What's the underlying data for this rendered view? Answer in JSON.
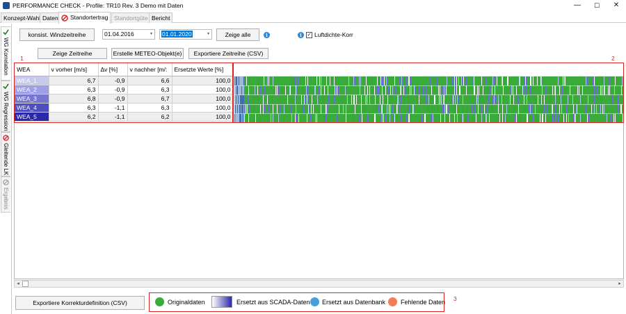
{
  "window": {
    "title": "PERFORMANCE CHECK - Profile: TR10 Rev. 3 Demo mit Daten",
    "controls": [
      "—",
      "☐",
      "✕"
    ]
  },
  "tabs": [
    {
      "label": "Konzept-Wahl",
      "state": "normal"
    },
    {
      "label": "Daten",
      "state": "normal"
    },
    {
      "label": "Standortertrag",
      "state": "active"
    },
    {
      "label": "Standortgüte",
      "state": "disabled"
    },
    {
      "label": "Bericht",
      "state": "normal"
    }
  ],
  "side_tabs": [
    {
      "label": "WG Korrelation",
      "icon": "check-icon"
    },
    {
      "label": "WG Regression",
      "icon": "check-icon"
    },
    {
      "label": "Gleitende LK",
      "icon": "blocked-icon"
    },
    {
      "label": "Ergebnis",
      "icon": "disabled-icon"
    }
  ],
  "toolbar": {
    "konsist_button": "konsist. Windzeitreihe",
    "start_date": "01.04.2016",
    "end_date": "01.01.2020",
    "show_all_button": "Zeige alle",
    "air_density_label": "Luftdichte-Korr",
    "air_density_checked": true,
    "show_series_button": "Zeige Zeitreihe",
    "create_meteo_button": "Erstelle METEO-Objekt(e)",
    "export_series_button": "Exportiere Zeitreihe (CSV)",
    "info_glyph": "i",
    "check_glyph": "✓",
    "dropdown_glyph": "▾"
  },
  "annotations": [
    "1",
    "2",
    "3"
  ],
  "table": {
    "columns": [
      "WEA",
      "v vorher [m/s]",
      "Δv [%]",
      "v nachher [m/:",
      "Ersetzte Werte [%]"
    ],
    "rows": [
      {
        "wea": "WEA_1",
        "v_before": "6,7",
        "delta": "-0,9",
        "v_after": "6,6",
        "replaced": "100,0",
        "color": "#c9c9f0"
      },
      {
        "wea": "WEA_2",
        "v_before": "6,3",
        "delta": "-0,9",
        "v_after": "6,3",
        "replaced": "100,0",
        "color": "#9f9fe6"
      },
      {
        "wea": "WEA_3",
        "v_before": "6,8",
        "delta": "-0,9",
        "v_after": "6,7",
        "replaced": "100,0",
        "color": "#7575d2"
      },
      {
        "wea": "WEA_4",
        "v_before": "6,3",
        "delta": "-1,1",
        "v_after": "6,3",
        "replaced": "100,0",
        "color": "#4f4fc0"
      },
      {
        "wea": "WEA_5",
        "v_before": "6,2",
        "delta": "-1,1",
        "v_after": "6,2",
        "replaced": "100,0",
        "color": "#2a2aa8"
      }
    ]
  },
  "scrollbar": {
    "left_arrow": "◂",
    "right_arrow": "▸"
  },
  "footer": {
    "export_button": "Exportiere Korrekturdefinition (CSV)"
  },
  "legend": [
    {
      "label": "Originaldaten",
      "color": "#3aaa3a",
      "kind": "dot"
    },
    {
      "label": "Ersetzt aus SCADA-Daten",
      "color": "#2a2aa8",
      "kind": "gradient"
    },
    {
      "label": "Ersetzt aus Datenbank",
      "color": "#4a9fd8",
      "kind": "dot"
    },
    {
      "label": "Fehlende Daten",
      "color": "#f07c5a",
      "kind": "dot"
    }
  ],
  "colors": {
    "original": "#3aaa3a",
    "scada": "#6a6ad8",
    "database": "#4a9fd8",
    "missing": "#f07c5a",
    "annotation_red": "#dd2222"
  }
}
